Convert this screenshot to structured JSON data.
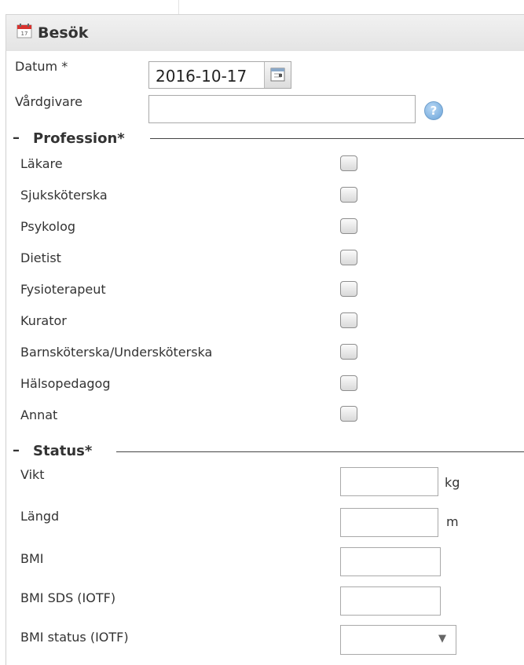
{
  "header": {
    "title": "Besök",
    "icon": "calendar-icon"
  },
  "form": {
    "date": {
      "label": "Datum *",
      "value": "2016-10-17"
    },
    "caregiver": {
      "label": "Vårdgivare",
      "value": ""
    }
  },
  "profession": {
    "title": "Profession*",
    "items": [
      {
        "label": "Läkare",
        "checked": false
      },
      {
        "label": "Sjuksköterska",
        "checked": false
      },
      {
        "label": "Psykolog",
        "checked": false
      },
      {
        "label": "Dietist",
        "checked": false
      },
      {
        "label": "Fysioterapeut",
        "checked": false
      },
      {
        "label": "Kurator",
        "checked": false
      },
      {
        "label": "Barnsköterska/Undersköterska",
        "checked": false
      },
      {
        "label": "Hälsopedagog",
        "checked": false
      },
      {
        "label": "Annat",
        "checked": false
      }
    ]
  },
  "status": {
    "title": "Status*",
    "weight": {
      "label": "Vikt",
      "unit": "kg",
      "value": ""
    },
    "height": {
      "label": "Längd",
      "unit": "m",
      "value": ""
    },
    "bmi": {
      "label": "BMI",
      "value": ""
    },
    "bmi_sds": {
      "label": "BMI SDS (IOTF)",
      "value": ""
    },
    "bmi_status": {
      "label": "BMI status (IOTF)",
      "value": ""
    }
  },
  "colors": {
    "help_icon": "#6aa3d8",
    "header_bg": "#e9e9e9"
  }
}
